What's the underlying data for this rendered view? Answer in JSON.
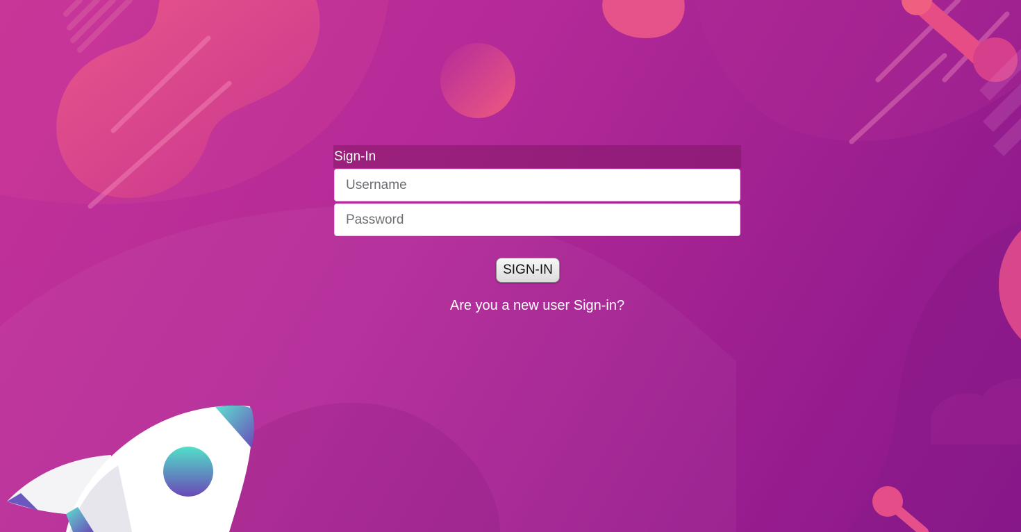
{
  "form": {
    "header_title": "Sign-In",
    "username_placeholder": "Username",
    "username_value": "",
    "password_placeholder": "Password",
    "password_value": "",
    "signin_button_label": "SIGN-IN",
    "new_user_text": "Are you a new user Sign-in?"
  },
  "colors": {
    "background_start": "#c33299",
    "background_end": "#86168a",
    "accent_pink": "#e4508a",
    "rocket_teal": "#5ee0d0",
    "rocket_purple": "#6a4ab8"
  },
  "decor": {
    "illustration": "rocket-icon"
  }
}
